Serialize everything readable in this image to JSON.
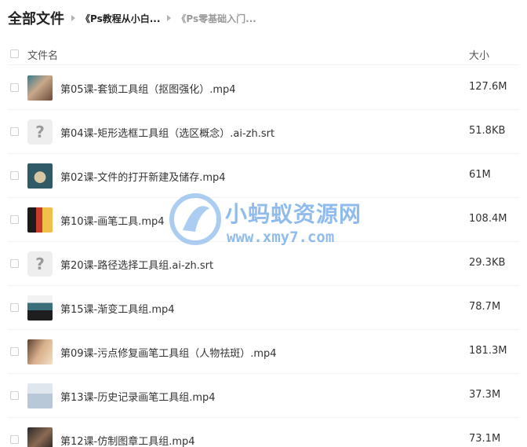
{
  "breadcrumb": {
    "root": "全部文件",
    "items": [
      "《Ps教程从小白...",
      "《Ps零基础入门..."
    ]
  },
  "list_header": {
    "name_label": "文件名",
    "size_label": "大小"
  },
  "files": [
    {
      "name": "第05课-套锁工具组（抠图强化）.mp4",
      "size": "127.6M",
      "thumb": "video-thumbnail-portrait"
    },
    {
      "name": "第04课-矩形选框工具组（选区概念）.ai-zh.srt",
      "size": "51.8KB",
      "thumb": "unknown-file-icon",
      "thumb_glyph": "?"
    },
    {
      "name": "第02课-文件的打开新建及储存.mp4",
      "size": "61M",
      "thumb": "video-thumbnail-circle"
    },
    {
      "name": "第10课-画笔工具.mp4",
      "size": "108.4M",
      "thumb": "video-thumbnail-brush"
    },
    {
      "name": "第20课-路径选择工具组.ai-zh.srt",
      "size": "29.3KB",
      "thumb": "unknown-file-icon",
      "thumb_glyph": "?"
    },
    {
      "name": "第15课-渐变工具组.mp4",
      "size": "78.7M",
      "thumb": "video-thumbnail-gradient"
    },
    {
      "name": "第09课-污点修复画笔工具组（人物祛斑）.mp4",
      "size": "181.3M",
      "thumb": "video-thumbnail-face"
    },
    {
      "name": "第13课-历史记录画笔工具组.mp4",
      "size": "37.3M",
      "thumb": "video-thumbnail-history"
    },
    {
      "name": "第12课-仿制图章工具组.mp4",
      "size": "73.1M",
      "thumb": "video-thumbnail-clone"
    }
  ],
  "watermark": {
    "title": "小蚂蚁资源网",
    "url": "www.xmy7.com",
    "color": "#6aa6e8"
  }
}
